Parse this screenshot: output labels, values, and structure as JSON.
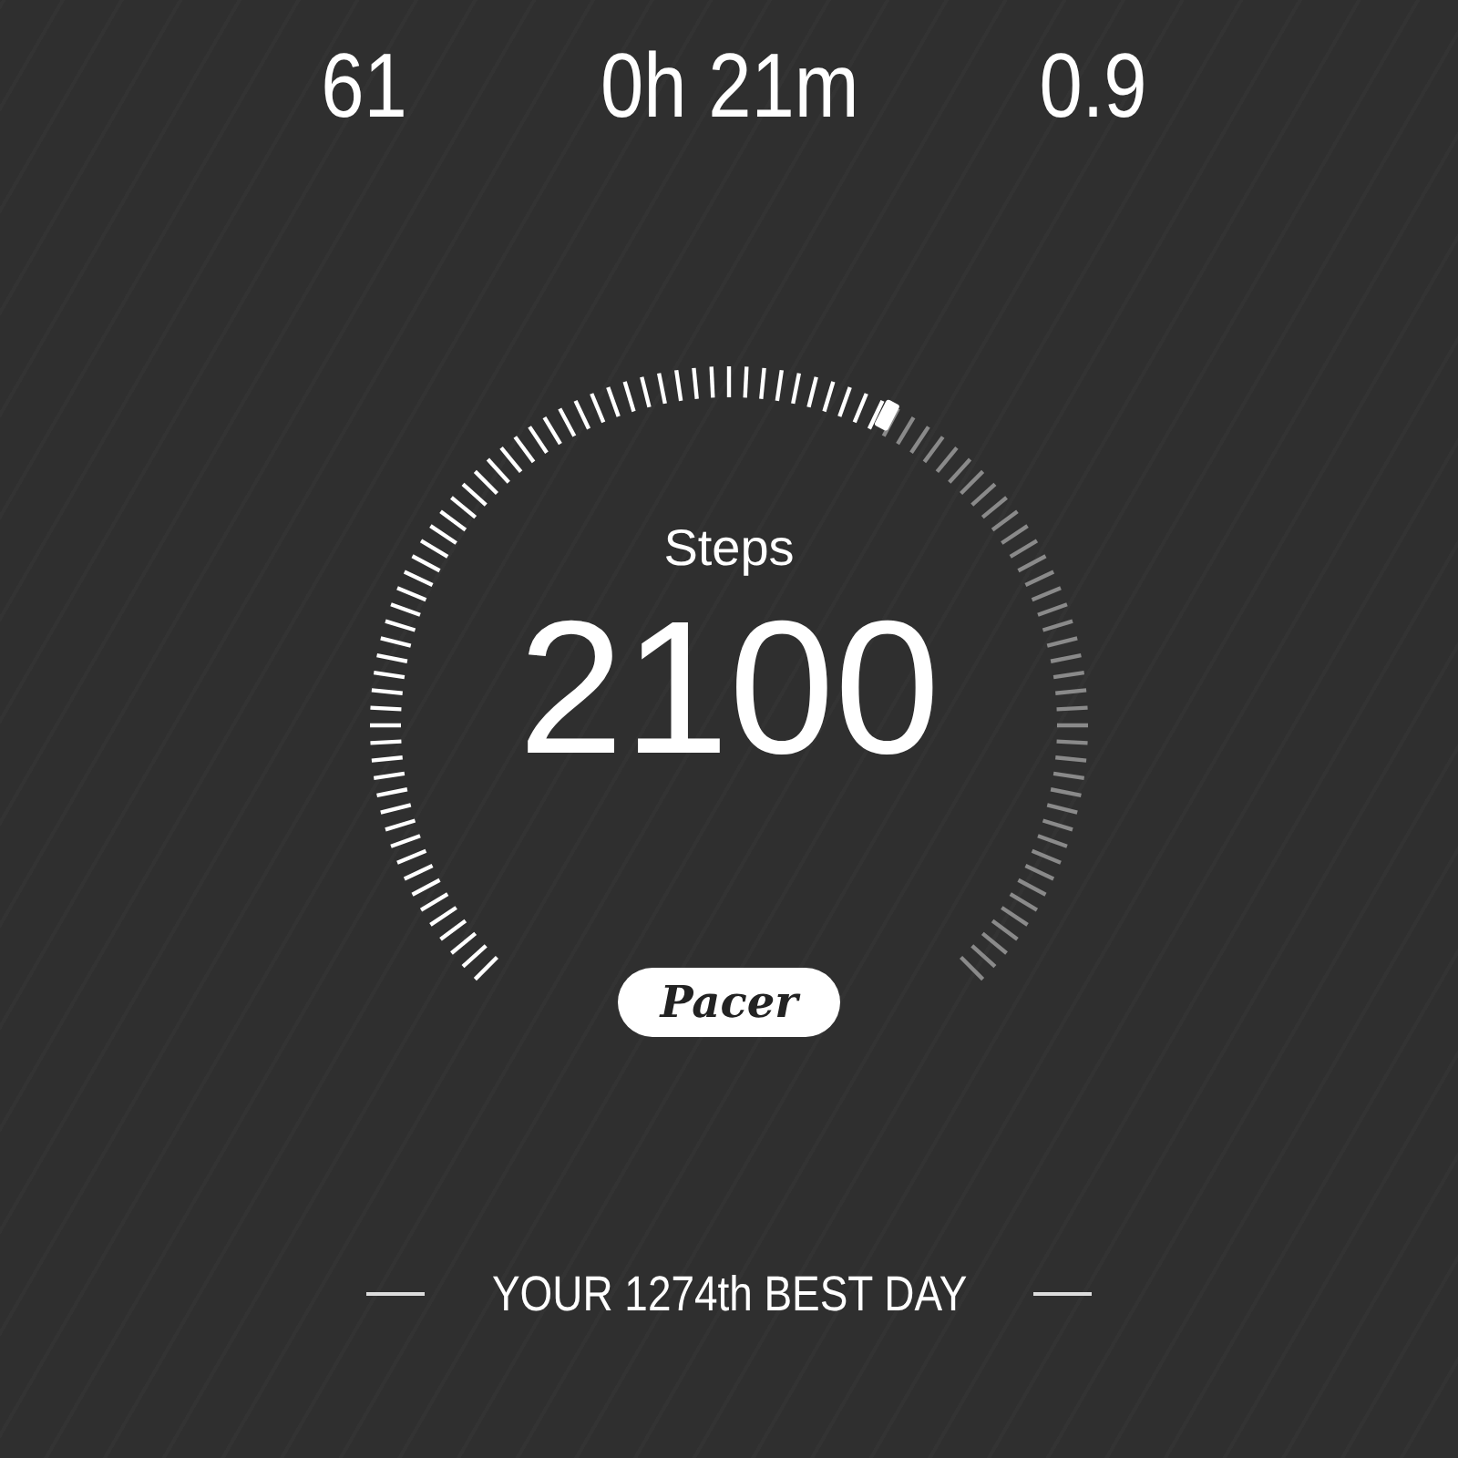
{
  "stats": [
    {
      "value": "61"
    },
    {
      "value": "0h 21m"
    },
    {
      "value": "0.9"
    }
  ],
  "gauge": {
    "label": "Steps",
    "value": "2100"
  },
  "badge": "Pacer",
  "footer": "YOUR 1274th BEST DAY"
}
